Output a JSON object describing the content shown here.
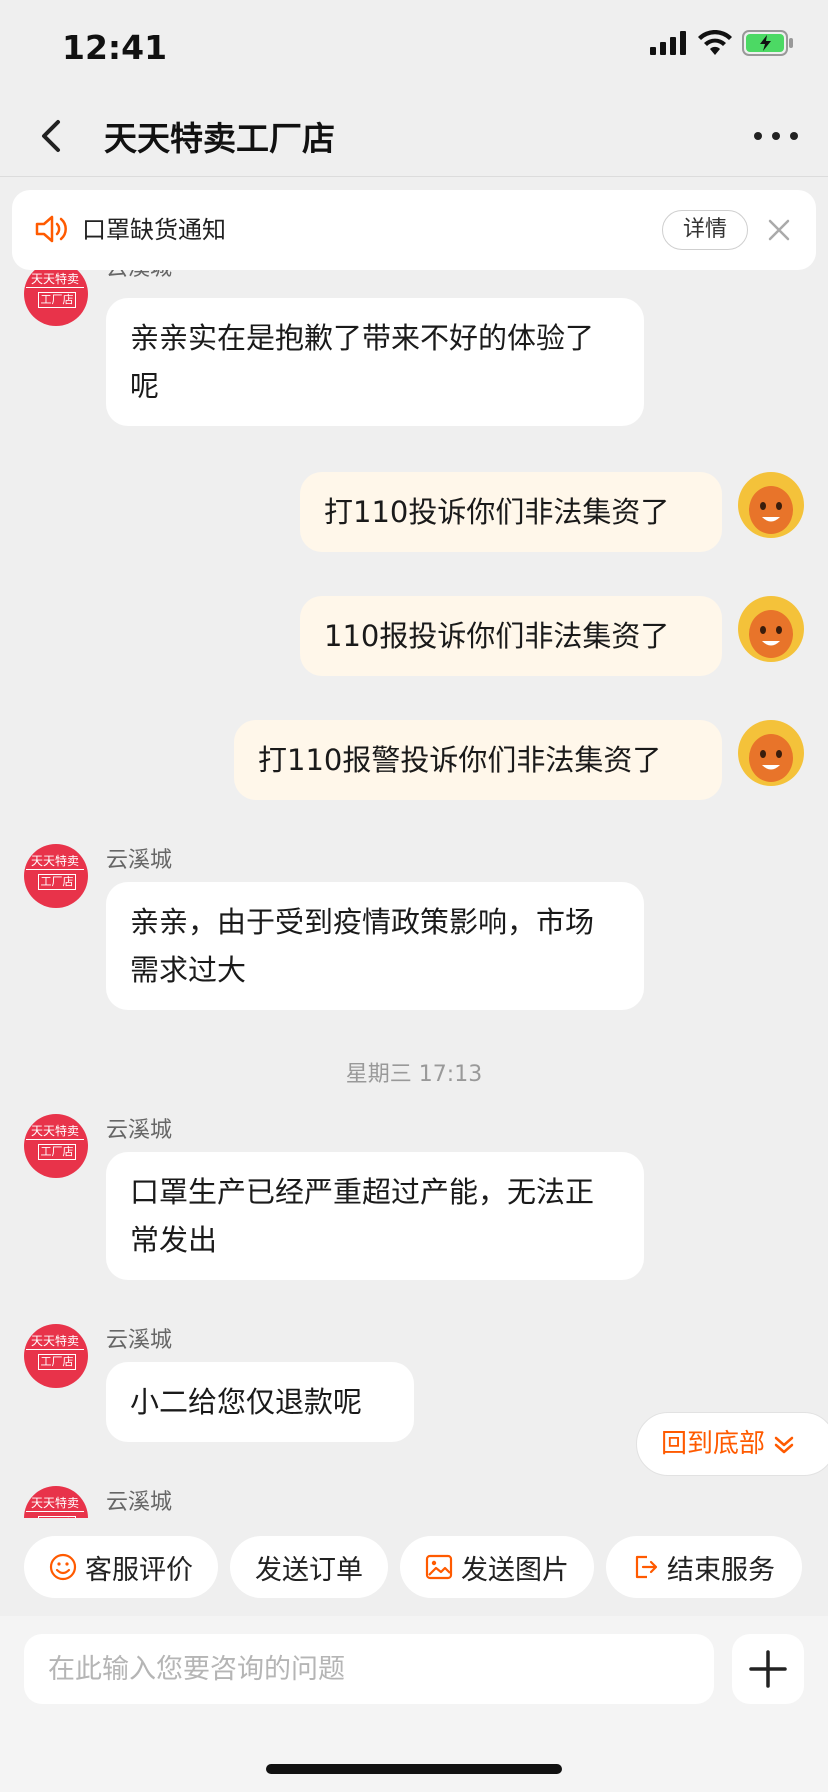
{
  "status_bar": {
    "time": "12:41"
  },
  "nav": {
    "title": "天天特卖工厂店"
  },
  "notice": {
    "text": "口罩缺货通知",
    "detail_label": "详情"
  },
  "messages": [
    {
      "side": "left",
      "sender": "云溪城",
      "text": "亲亲实在是抱歉了带来不好的体验了呢"
    },
    {
      "side": "right",
      "text": "打110投诉你们非法集资了"
    },
    {
      "side": "right",
      "text": "110报投诉你们非法集资了"
    },
    {
      "side": "right",
      "text": "打110报警投诉你们非法集资了"
    },
    {
      "side": "left",
      "sender": "云溪城",
      "text": "亲亲，由于受到疫情政策影响，市场需求过大"
    },
    {
      "side": "time",
      "text": "星期三 17:13"
    },
    {
      "side": "left",
      "sender": "云溪城",
      "text": "口罩生产已经严重超过产能，无法正常发出"
    },
    {
      "side": "left",
      "sender": "云溪城",
      "text": "小二给您仅退款呢"
    },
    {
      "side": "left",
      "sender": "云溪城",
      "text": ""
    }
  ],
  "shop_avatar": {
    "line1": "天天特卖",
    "line2": "工厂店"
  },
  "back_to_bottom": "回到底部",
  "quick_actions": {
    "rate": "客服评价",
    "send_order": "发送订单",
    "send_image": "发送图片",
    "end_service": "结束服务"
  },
  "input": {
    "placeholder": "在此输入您要咨询的问题"
  },
  "colors": {
    "accent": "#ff5a00",
    "shop_red": "#e8334a",
    "user_bubble": "#fff7ea"
  }
}
